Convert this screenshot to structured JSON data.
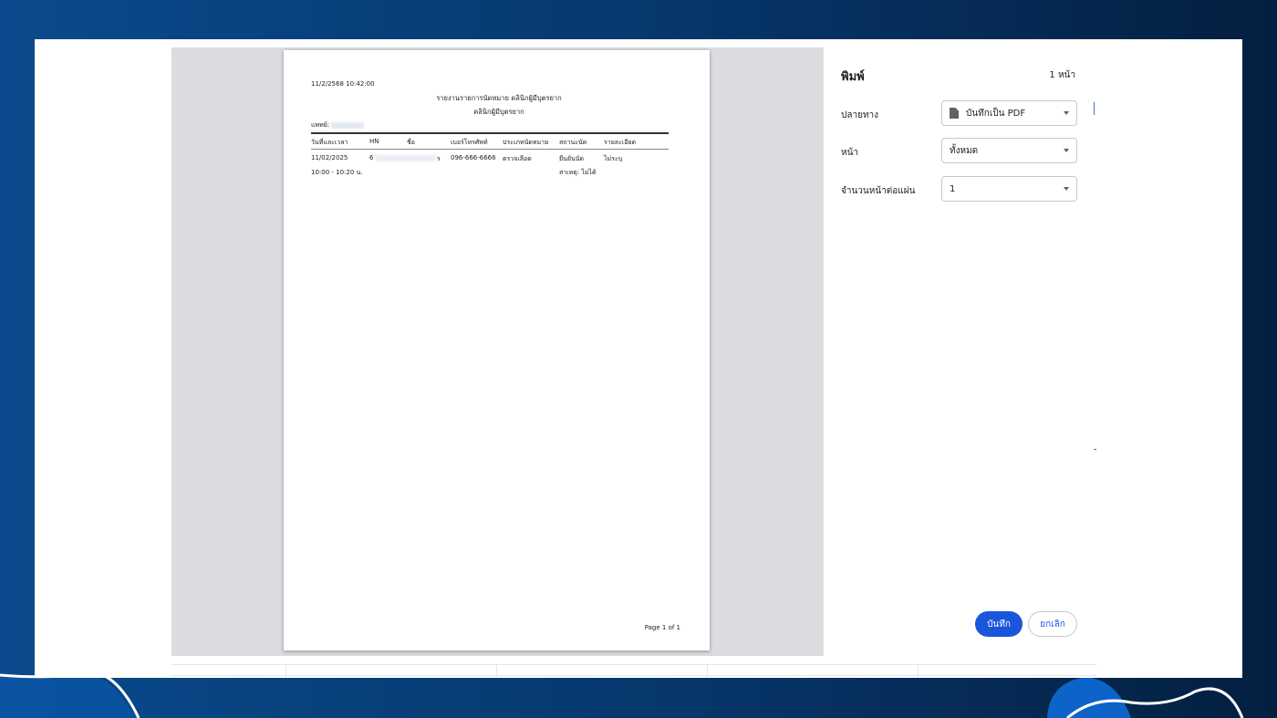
{
  "preview": {
    "printed_at": "11/2/2568 10:42:00",
    "report_title": "รายงานรายการนัดหมาย คลินิกผู้มีบุตรยาก",
    "clinic_name": "คลินิกผู้มีบุตรยาก",
    "doctor_label": "แพทย์:",
    "table": {
      "headers": [
        "วันที่และเวลา",
        "HN",
        "ชื่อ",
        "เบอร์โทรศัพท์",
        "ประเภทนัดหมาย",
        "สถานะนัด",
        "รายละเอียด"
      ],
      "rows": [
        {
          "date": "11/02/2025",
          "time": "10:00 - 10:20 น.",
          "hn": "6",
          "name_tail": "ร",
          "phone": "096-666-6666",
          "type": "ตรวจเลือด",
          "status": "ยืนยันนัด",
          "reason": "สาเหตุ: ไม่ได้",
          "detail": "ไม่ระบุ"
        }
      ]
    },
    "page_footer": "Page 1 of 1"
  },
  "sidebar": {
    "title": "พิมพ์",
    "page_count": "1 หน้า",
    "destination_label": "ปลายทาง",
    "destination_value": "บันทึกเป็น PDF",
    "pages_label": "หน้า",
    "pages_value": "ทั้งหมด",
    "per_sheet_label": "จำนวนหน้าต่อแผ่น",
    "per_sheet_value": "1",
    "save_label": "บันทึก",
    "cancel_label": "ยกเลิก"
  },
  "colors": {
    "accent": "#1a56db",
    "preview_bg": "#dadce0",
    "backdrop": "#07386e"
  }
}
